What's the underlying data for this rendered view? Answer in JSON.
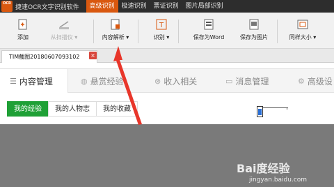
{
  "app": {
    "logo_text": "OCR",
    "title": "捷速OCR文字识别软件"
  },
  "top_tabs": [
    {
      "label": "高级识别",
      "active": true
    },
    {
      "label": "极速识别",
      "active": false
    },
    {
      "label": "票证识别",
      "active": false
    },
    {
      "label": "图片局部识别",
      "active": false
    }
  ],
  "toolbar": {
    "add": "添加",
    "scan": "从扫描仪",
    "parse": "内容解析",
    "recognize": "识别",
    "save_word": "保存为Word",
    "save_image": "保存为图片",
    "same_size": "同样大小"
  },
  "doc_tab": {
    "name": "TIM截图20180607093102",
    "close_glyph": "×"
  },
  "nav": {
    "items": [
      {
        "label": "内容管理",
        "icon": "list-icon"
      },
      {
        "label": "悬赏经验",
        "icon": "reward-icon"
      },
      {
        "label": "收入相关",
        "icon": "yen-icon"
      },
      {
        "label": "消息管理",
        "icon": "message-icon"
      },
      {
        "label": "高级设",
        "icon": "gear-icon"
      }
    ]
  },
  "subtabs": [
    "我的经验",
    "我的人物志",
    "我的收藏"
  ],
  "watermark": {
    "main": "Bai度经验",
    "sub": "jingyan.baidu.com"
  },
  "colors": {
    "accent": "#d9580f",
    "green": "#1fa036",
    "arrow": "#e8362a"
  }
}
